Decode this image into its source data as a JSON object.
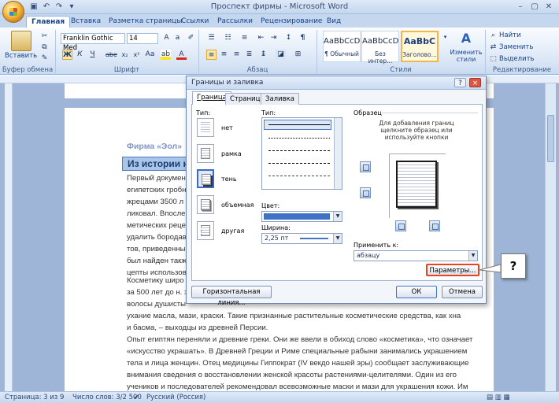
{
  "window": {
    "title": "Проспект фирмы - Microsoft Word",
    "quick_access": [
      "save-icon",
      "undo-icon",
      "redo-icon"
    ]
  },
  "tabs": [
    "Главная",
    "Вставка",
    "Разметка страницы",
    "Ссылки",
    "Рассылки",
    "Рецензирование",
    "Вид"
  ],
  "ribbon": {
    "paste_label": "Вставить",
    "clipboard_label": "Буфер обмена",
    "font_name": "Franklin Gothic Med",
    "font_size": "14",
    "font_group_label": "Шрифт",
    "paragraph_group_label": "Абзац",
    "styles": [
      {
        "sample": "AaBbCcD",
        "name": "¶ Обычный"
      },
      {
        "sample": "AaBbCcD",
        "name": "Без интер..."
      },
      {
        "sample": "AaBbC",
        "name": "Заголово..."
      }
    ],
    "change_styles_label": "Изменить стили",
    "styles_group_label": "Стили",
    "find_label": "Найти",
    "replace_label": "Заменить",
    "select_label": "Выделить",
    "editing_group_label": "Редактирование"
  },
  "document": {
    "heading1": "Фирма «Эол»",
    "heading2": "Из истории к",
    "para1_lines": [
      "Первый документ",
      "египетских гробн",
      "жрецами 3500 л",
      "ликовал. Впосле",
      "метических реце",
      "удалить бородав",
      "тов, приведенны",
      "был найден такж",
      "цепты использов"
    ],
    "para2_lines": [
      "Косметику широ",
      "за 500 лет до н. з",
      "волосы душисты",
      "ухание масла, мази, краски. Такие признанные растительные косметические средства, как хна",
      "и басма, – выходцы из древней Персии."
    ],
    "para3_lines": [
      "Опыт египтян переняли и древние греки. Они же ввели в обиход слово «косметика», что означает",
      "«искусство украшать». В Древней Греции и Риме специальные рабыни занимались украшением",
      "тела и лица женщин. Отец медицины Гиппократ (IV векдо нашей эры) сообщает заслуживающие",
      "внимания сведения о восстановлении женской красоты растениями-целителями. Один из его",
      "учеников и последователей рекомендовал всевозможные маски и мази для украшения кожи. Им"
    ]
  },
  "dialog": {
    "title": "Границы и заливка",
    "help": "?",
    "close": "×",
    "tabs": [
      "Граница",
      "Страница",
      "Заливка"
    ],
    "type_label": "Тип:",
    "settings": [
      "нет",
      "рамка",
      "тень",
      "объемная",
      "другая"
    ],
    "style_label": "Тип:",
    "color_label": "Цвет:",
    "width_label": "Ширина:",
    "width_value": "2,25 пт",
    "preview_label": "Образец",
    "preview_hint": "Для добавления границ щелкните образец или используйте кнопки",
    "apply_to_label": "Применить к:",
    "apply_to_value": "абзацу",
    "options_button": "Параметры...",
    "hline_button": "Горизонтальная линия...",
    "ok_button": "ОК",
    "cancel_button": "Отмена"
  },
  "callout": "?",
  "status": {
    "page": "Страница: 3 из 9",
    "words": "Число слов: 3/2 500",
    "language": "Русский (Россия)"
  },
  "colors": {
    "ribbon_bg": "#dbe7f6",
    "accent": "#15428b",
    "highlight": "#e8451e",
    "border_color": "#3e72c4"
  }
}
